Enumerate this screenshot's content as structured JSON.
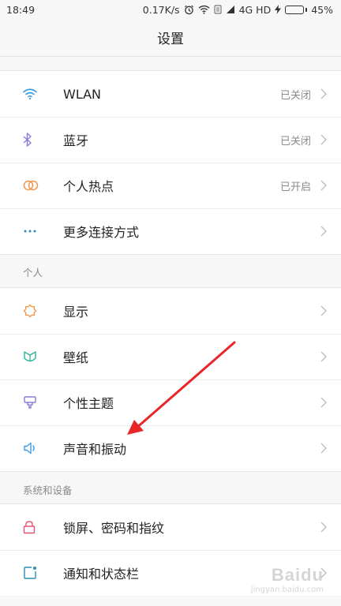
{
  "status_bar": {
    "time": "18:49",
    "network_speed": "0.17K/s",
    "network_type": "4G HD",
    "battery": "45%",
    "battery_level": 0.45,
    "battery_color": "#4fc13a",
    "icons": [
      "alarm-icon",
      "wifi-icon",
      "no-sim-icon",
      "signal-icon",
      "charging-icon",
      "battery-icon"
    ]
  },
  "header": {
    "title": "设置"
  },
  "sections": {
    "connectivity": {
      "items": [
        {
          "label": "WLAN",
          "value": "已关闭",
          "icon": "wifi-icon",
          "icon_color": "#3d9be3"
        },
        {
          "label": "蓝牙",
          "value": "已关闭",
          "icon": "bluetooth-icon",
          "icon_color": "#8c7ad6"
        },
        {
          "label": "个人热点",
          "value": "已开启",
          "icon": "hotspot-icon",
          "icon_color": "#f0964a"
        },
        {
          "label": "更多连接方式",
          "value": "",
          "icon": "more-dots-icon",
          "icon_color": "#2a8fb8"
        }
      ]
    },
    "personal": {
      "title": "个人",
      "items": [
        {
          "label": "显示",
          "icon": "brightness-icon",
          "icon_color": "#f0964a"
        },
        {
          "label": "壁纸",
          "icon": "wallpaper-icon",
          "icon_color": "#2db59a"
        },
        {
          "label": "个性主题",
          "icon": "theme-brush-icon",
          "icon_color": "#8c7ad6"
        },
        {
          "label": "声音和振动",
          "icon": "speaker-icon",
          "icon_color": "#3d9be3"
        }
      ]
    },
    "system": {
      "title": "系统和设备",
      "items": [
        {
          "label": "锁屏、密码和指纹",
          "icon": "lock-icon",
          "icon_color": "#e0566e"
        },
        {
          "label": "通知和状态栏",
          "icon": "notification-icon",
          "icon_color": "#2a8fb8"
        }
      ]
    }
  },
  "annotation": {
    "color": "#e8262a"
  },
  "watermark": {
    "logo": "Baidu",
    "subtitle": "jingyan.baidu.com"
  }
}
